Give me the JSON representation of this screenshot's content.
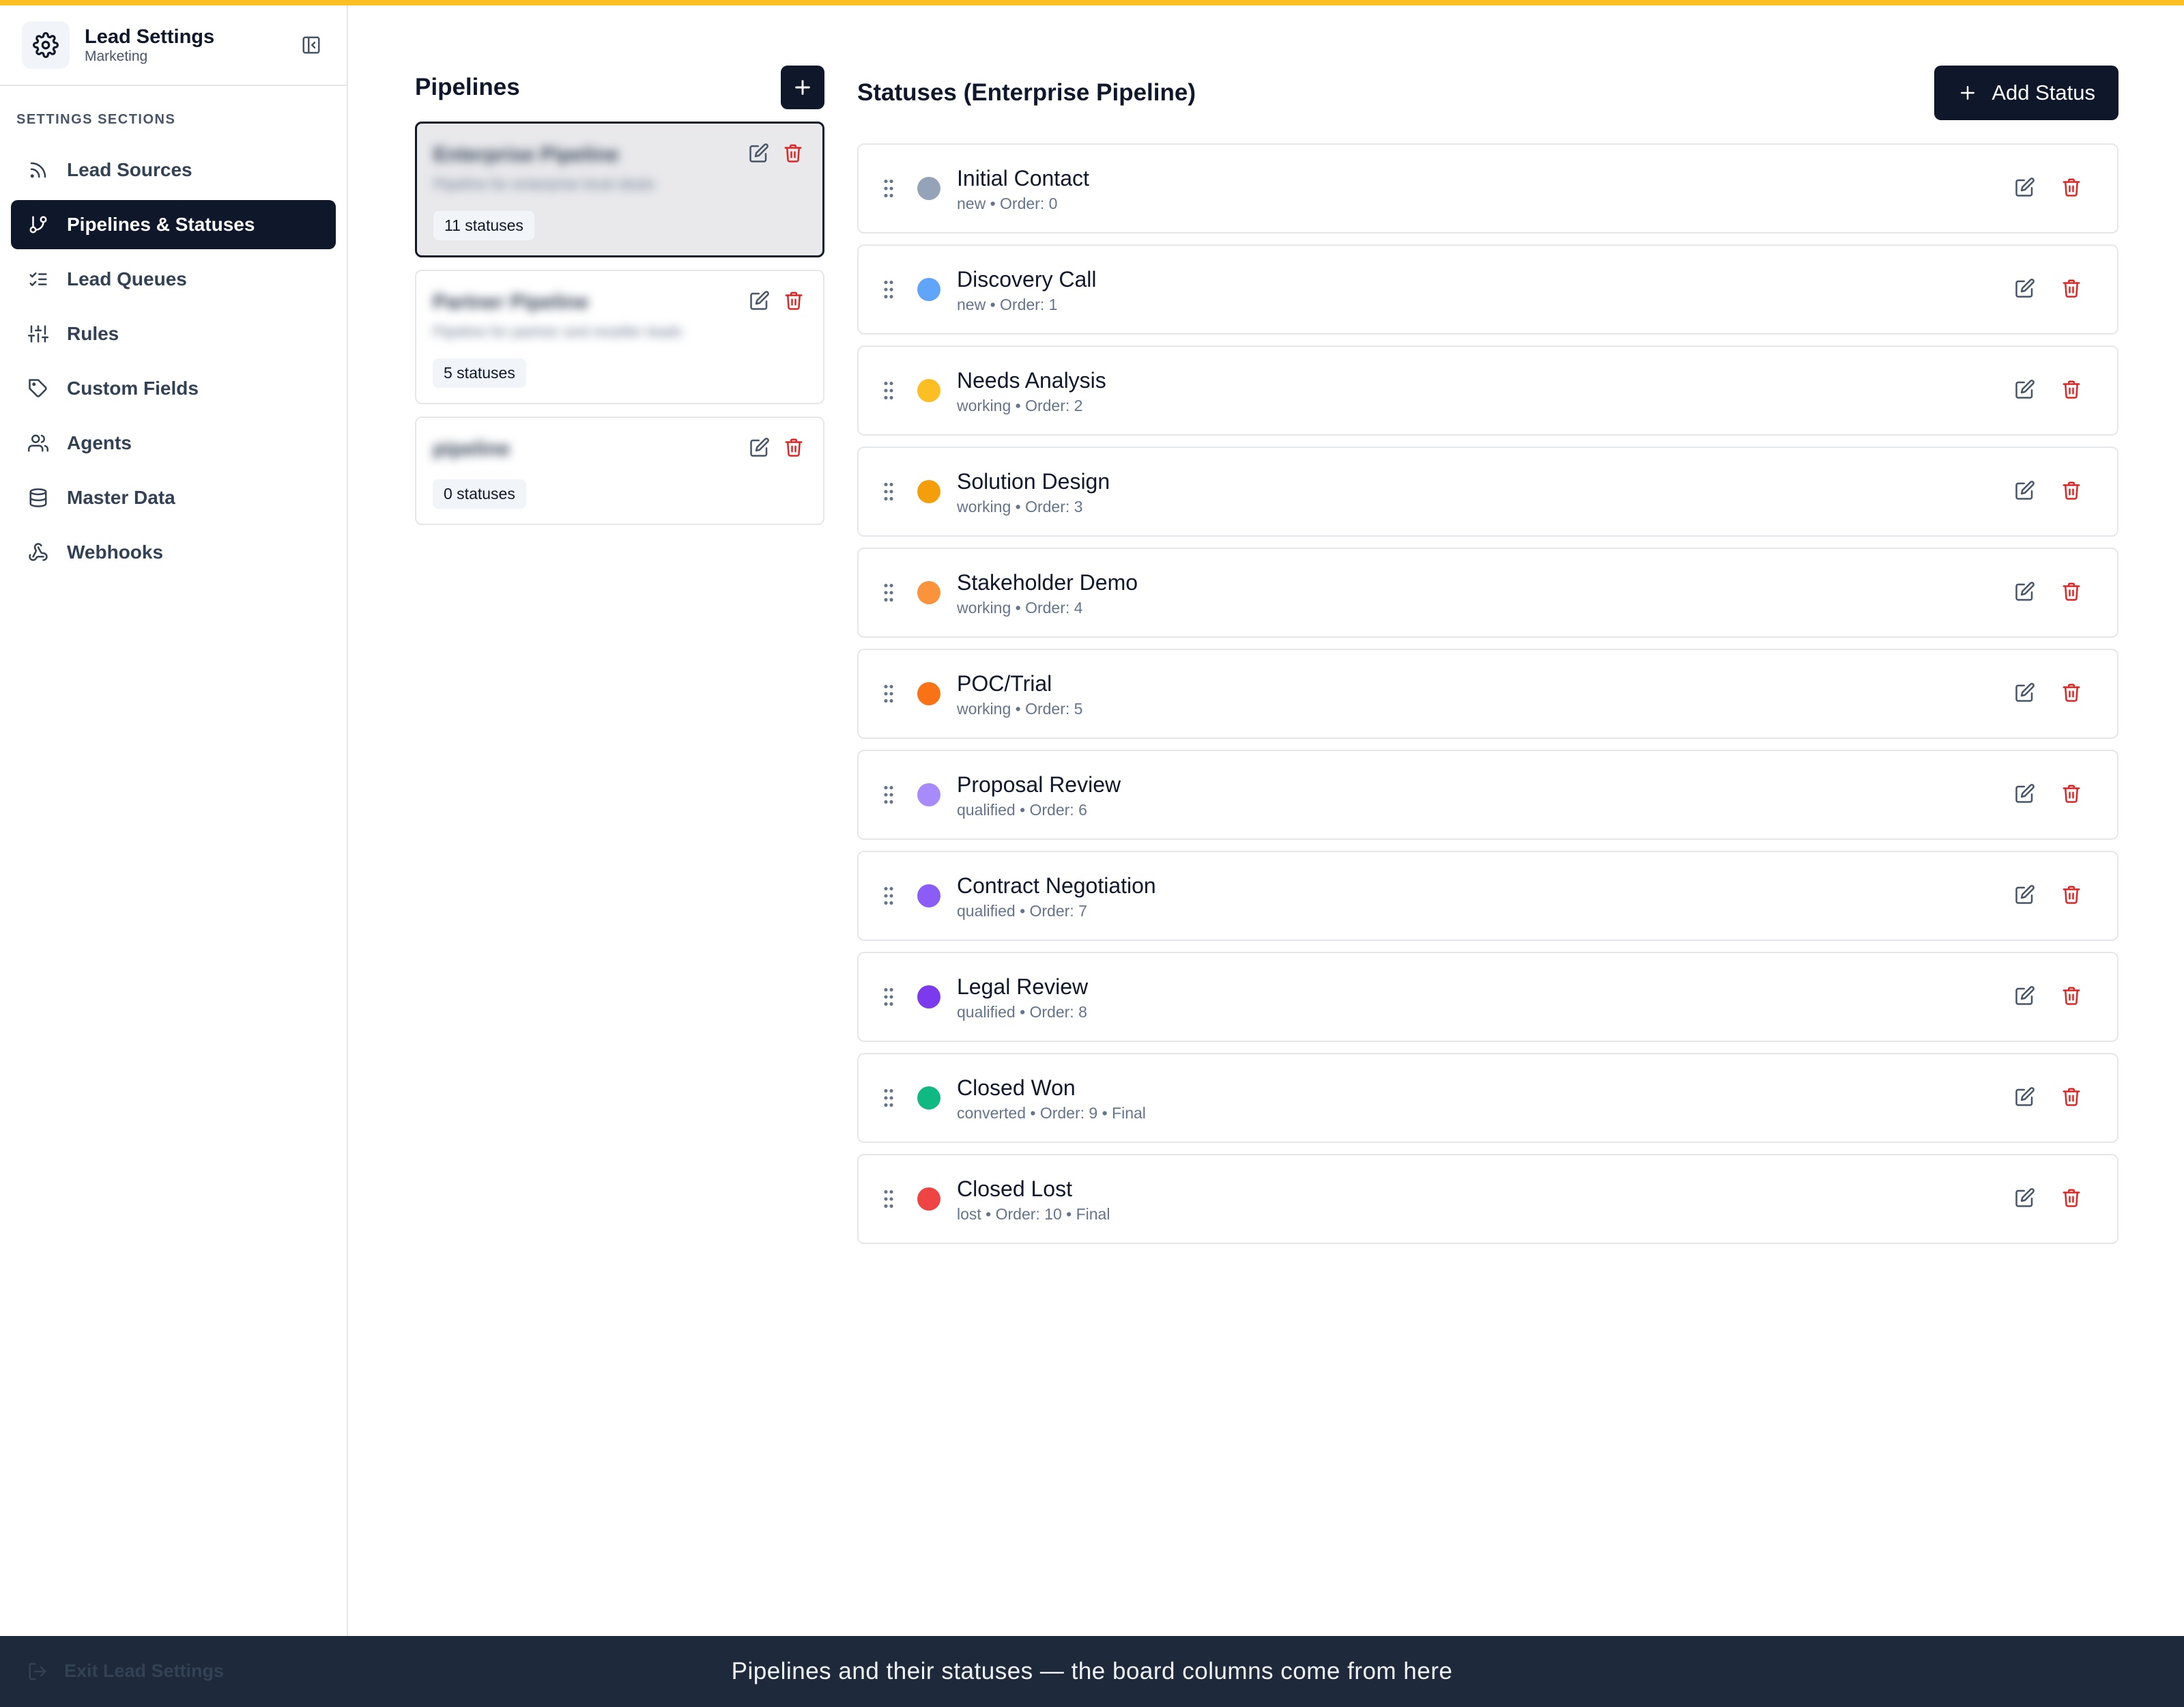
{
  "app": {
    "title": "Lead Settings",
    "subtitle": "Marketing"
  },
  "sidebar": {
    "section_label": "SETTINGS SECTIONS",
    "items": [
      {
        "label": "Lead Sources",
        "icon": "rss-icon"
      },
      {
        "label": "Pipelines & Statuses",
        "icon": "git-branch-icon",
        "active": true
      },
      {
        "label": "Lead Queues",
        "icon": "list-checks-icon"
      },
      {
        "label": "Rules",
        "icon": "sliders-icon"
      },
      {
        "label": "Custom Fields",
        "icon": "tag-icon"
      },
      {
        "label": "Agents",
        "icon": "users-icon"
      },
      {
        "label": "Master Data",
        "icon": "database-icon"
      },
      {
        "label": "Webhooks",
        "icon": "webhook-icon"
      }
    ],
    "exit_label": "Exit Lead Settings"
  },
  "pipelines": {
    "title": "Pipelines",
    "items": [
      {
        "name": "Enterprise Pipeline",
        "description": "Pipeline for enterprise level deals",
        "count": "11 statuses",
        "active": true
      },
      {
        "name": "Partner Pipeline",
        "description": "Pipeline for partner and reseller leads",
        "count": "5 statuses"
      },
      {
        "name": "pipeline",
        "description": "",
        "count": "0 statuses"
      }
    ]
  },
  "statuses": {
    "title": "Statuses (Enterprise Pipeline)",
    "add_label": "Add Status",
    "items": [
      {
        "name": "Initial Contact",
        "meta": "new • Order: 0",
        "color": "#94a3b8"
      },
      {
        "name": "Discovery Call",
        "meta": "new • Order: 1",
        "color": "#60a5fa"
      },
      {
        "name": "Needs Analysis",
        "meta": "working • Order: 2",
        "color": "#fbbf24"
      },
      {
        "name": "Solution Design",
        "meta": "working • Order: 3",
        "color": "#f59e0b"
      },
      {
        "name": "Stakeholder Demo",
        "meta": "working • Order: 4",
        "color": "#fb923c"
      },
      {
        "name": "POC/Trial",
        "meta": "working • Order: 5",
        "color": "#f97316"
      },
      {
        "name": "Proposal Review",
        "meta": "qualified • Order: 6",
        "color": "#a78bfa"
      },
      {
        "name": "Contract Negotiation",
        "meta": "qualified • Order: 7",
        "color": "#8b5cf6"
      },
      {
        "name": "Legal Review",
        "meta": "qualified • Order: 8",
        "color": "#7c3aed"
      },
      {
        "name": "Closed Won",
        "meta": "converted • Order: 9 • Final",
        "color": "#10b981"
      },
      {
        "name": "Closed Lost",
        "meta": "lost • Order: 10 • Final",
        "color": "#ef4444"
      }
    ]
  },
  "caption": "Pipelines and their statuses — the board columns come from here",
  "colors": {
    "accent_bar": "#fbbf24",
    "primary": "#0f172a",
    "danger": "#dc2626"
  }
}
